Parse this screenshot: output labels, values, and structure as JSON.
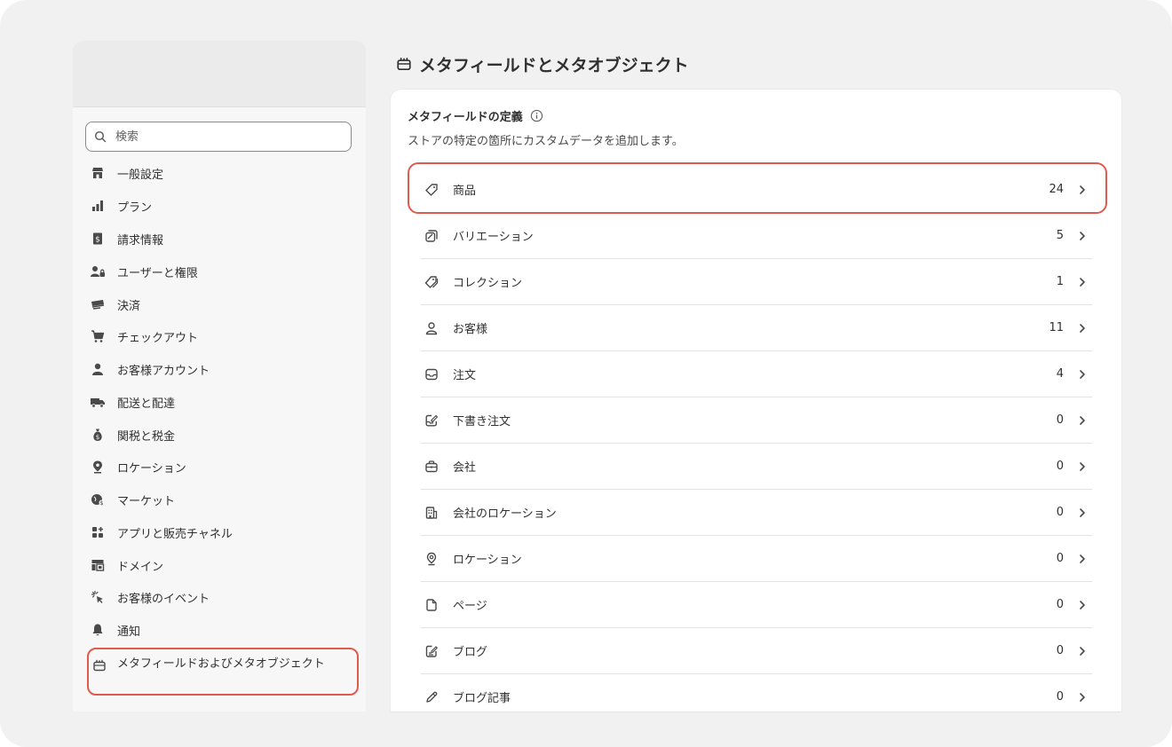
{
  "search": {
    "placeholder": "検索"
  },
  "sidebar": {
    "items": [
      {
        "label": "一般設定",
        "icon": "store-icon"
      },
      {
        "label": "プラン",
        "icon": "plan-chart-icon"
      },
      {
        "label": "請求情報",
        "icon": "receipt-icon"
      },
      {
        "label": "ユーザーと権限",
        "icon": "users-lock-icon"
      },
      {
        "label": "決済",
        "icon": "payment-card-icon"
      },
      {
        "label": "チェックアウト",
        "icon": "cart-icon"
      },
      {
        "label": "お客様アカウント",
        "icon": "person-icon"
      },
      {
        "label": "配送と配達",
        "icon": "truck-icon"
      },
      {
        "label": "関税と税金",
        "icon": "money-bag-icon"
      },
      {
        "label": "ロケーション",
        "icon": "location-pin-icon"
      },
      {
        "label": "マーケット",
        "icon": "globe-icon"
      },
      {
        "label": "アプリと販売チャネル",
        "icon": "apps-icon"
      },
      {
        "label": "ドメイン",
        "icon": "domain-icon"
      },
      {
        "label": "お客様のイベント",
        "icon": "cursor-click-icon"
      },
      {
        "label": "通知",
        "icon": "bell-icon"
      },
      {
        "label": "メタフィールドおよびメタオブジェクト",
        "icon": "metafields-icon"
      }
    ]
  },
  "page": {
    "title": "メタフィールドとメタオブジェクト"
  },
  "card": {
    "title": "メタフィールドの定義",
    "description": "ストアの特定の箇所にカスタムデータを追加します。"
  },
  "rows": [
    {
      "label": "商品",
      "count": "24",
      "icon": "tag-icon"
    },
    {
      "label": "バリエーション",
      "count": "5",
      "icon": "variant-icon"
    },
    {
      "label": "コレクション",
      "count": "1",
      "icon": "collection-tag-icon"
    },
    {
      "label": "お客様",
      "count": "11",
      "icon": "person-outline-icon"
    },
    {
      "label": "注文",
      "count": "4",
      "icon": "inbox-icon"
    },
    {
      "label": "下書き注文",
      "count": "0",
      "icon": "draft-order-icon"
    },
    {
      "label": "会社",
      "count": "0",
      "icon": "briefcase-icon"
    },
    {
      "label": "会社のロケーション",
      "count": "0",
      "icon": "building-icon"
    },
    {
      "label": "ロケーション",
      "count": "0",
      "icon": "location-outline-icon"
    },
    {
      "label": "ページ",
      "count": "0",
      "icon": "page-icon"
    },
    {
      "label": "ブログ",
      "count": "0",
      "icon": "blog-icon"
    },
    {
      "label": "ブログ記事",
      "count": "0",
      "icon": "pencil-icon"
    }
  ],
  "colors": {
    "highlight": "#e05a4e",
    "frame": "#f1f1f1",
    "text": "#303030"
  }
}
